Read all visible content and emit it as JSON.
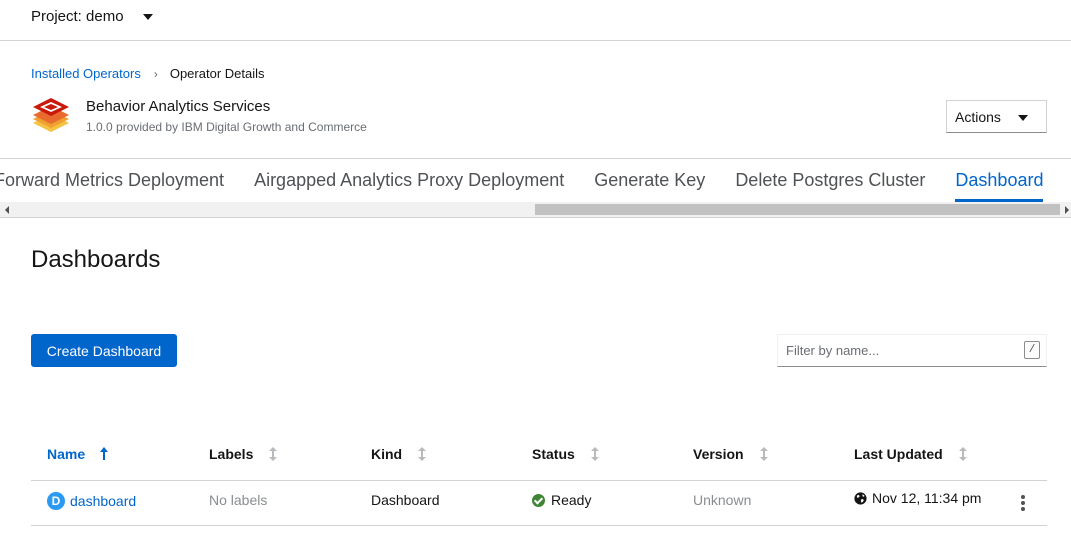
{
  "project": {
    "label": "Project: demo"
  },
  "breadcrumb": {
    "parent": "Installed Operators",
    "current": "Operator Details"
  },
  "operator": {
    "name": "Behavior Analytics Services",
    "subtitle": "1.0.0 provided by IBM Digital Growth and Commerce",
    "logo_icon": "operator-logo-icon"
  },
  "actions": {
    "label": "Actions"
  },
  "tabs": [
    {
      "label": "Forward Metrics Deployment",
      "active": false
    },
    {
      "label": "Airgapped Analytics Proxy Deployment",
      "active": false
    },
    {
      "label": "Generate Key",
      "active": false
    },
    {
      "label": "Delete Postgres Cluster",
      "active": false
    },
    {
      "label": "Dashboard",
      "active": true
    }
  ],
  "page": {
    "title": "Dashboards",
    "create_button": "Create Dashboard",
    "filter_placeholder": "Filter by name...",
    "filter_shortcut": "/"
  },
  "table": {
    "columns": [
      "Name",
      "Labels",
      "Kind",
      "Status",
      "Version",
      "Last Updated"
    ],
    "sorted_column": "Name",
    "rows": [
      {
        "badge": "D",
        "name": "dashboard",
        "labels": "No labels",
        "kind": "Dashboard",
        "status": "Ready",
        "version": "Unknown",
        "last_updated": "Nov 12, 11:34 pm"
      }
    ]
  },
  "colors": {
    "accent": "#0066cc",
    "ready": "#3e8635",
    "badge": "#2b9af3"
  }
}
